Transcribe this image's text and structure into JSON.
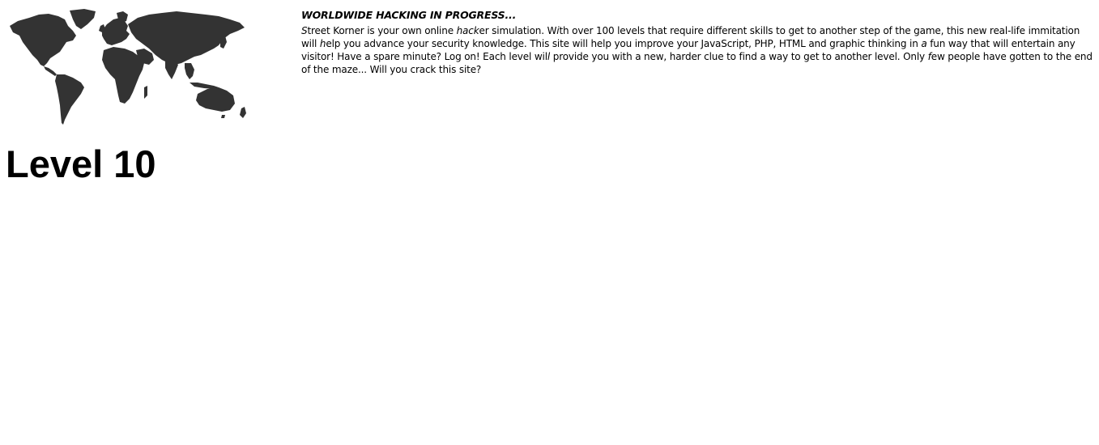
{
  "header": {
    "map_image": "world-map",
    "map_color": "#333333"
  },
  "intro": {
    "headline": "WORLDWIDE HACKING IN PROGRESS...",
    "segments": [
      {
        "text": "S",
        "italic": true
      },
      {
        "text": "treet Korner is your own online ",
        "italic": false
      },
      {
        "text": "hack",
        "italic": true
      },
      {
        "text": "er simulation. W",
        "italic": false
      },
      {
        "text": "i",
        "italic": true
      },
      {
        "text": "th over 100 levels that require different skills to get to another step of the game, this new real-life immitation will ",
        "italic": false
      },
      {
        "text": "h",
        "italic": true
      },
      {
        "text": "elp you advance your security knowledge. This site will help you improve your JavaScript, PHP, HTML and graphic thinking in ",
        "italic": false
      },
      {
        "text": "a",
        "italic": true
      },
      {
        "text": " fun way that will entertain any visitor! Have a spare minute? Log on! Each level wil",
        "italic": false
      },
      {
        "text": "l",
        "italic": true
      },
      {
        "text": " provide you with a new, harder clue to find a way to get to another level. Only ",
        "italic": false
      },
      {
        "text": "f",
        "italic": true
      },
      {
        "text": "ew people have gotten to the end of the maze... Will you crack this site?",
        "italic": false
      }
    ]
  },
  "level": {
    "title": "Level 10"
  }
}
